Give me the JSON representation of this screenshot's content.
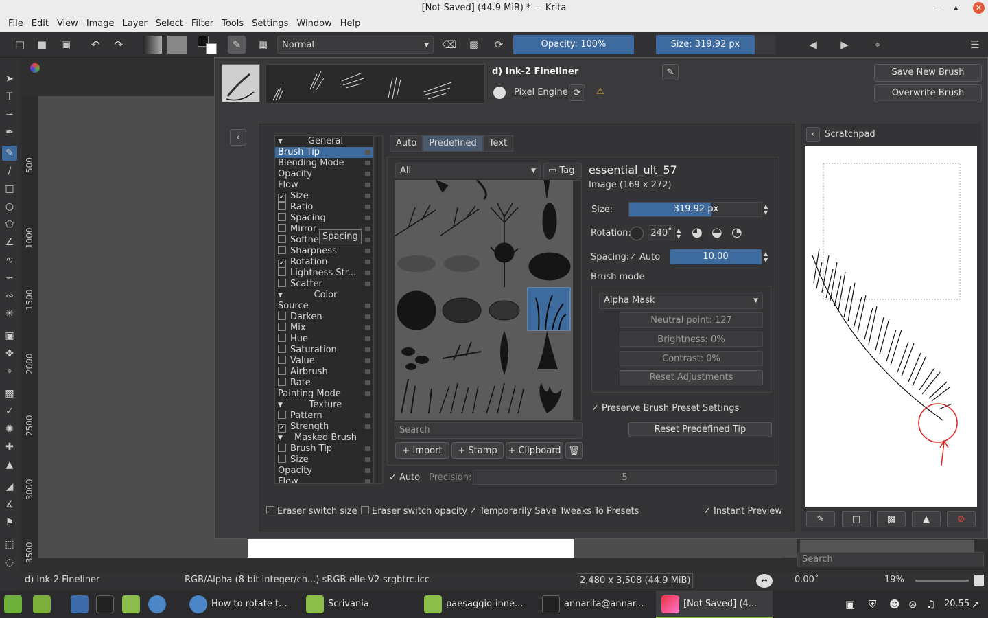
{
  "window": {
    "title": "[Not Saved]  (44.9 MiB)  * — Krita"
  },
  "menu": [
    "File",
    "Edit",
    "View",
    "Image",
    "Layer",
    "Select",
    "Filter",
    "Tools",
    "Settings",
    "Window",
    "Help"
  ],
  "toolbar": {
    "blend_mode": "Normal",
    "opacity": "Opacity: 100%",
    "size": "Size: 319.92 px"
  },
  "preset": {
    "name": "d) Ink-2 Fineliner",
    "engine": "Pixel Engine",
    "save_new": "Save New Brush Preset...",
    "overwrite": "Overwrite Brush"
  },
  "options_list": [
    {
      "label": "General",
      "type": "header"
    },
    {
      "label": "Brush Tip",
      "type": "plain",
      "selected": true
    },
    {
      "label": "Blending Mode",
      "type": "plain"
    },
    {
      "label": "Opacity",
      "type": "plain"
    },
    {
      "label": "Flow",
      "type": "plain"
    },
    {
      "label": "Size",
      "type": "check",
      "checked": true
    },
    {
      "label": "Ratio",
      "type": "check"
    },
    {
      "label": "Spacing",
      "type": "check"
    },
    {
      "label": "Mirror",
      "type": "check"
    },
    {
      "label": "Softnes",
      "type": "check"
    },
    {
      "label": "Sharpness",
      "type": "check"
    },
    {
      "label": "Rotation",
      "type": "check",
      "checked": true
    },
    {
      "label": "Lightness Str...",
      "type": "check"
    },
    {
      "label": "Scatter",
      "type": "check"
    },
    {
      "label": "Color",
      "type": "header"
    },
    {
      "label": "Source",
      "type": "plain"
    },
    {
      "label": "Darken",
      "type": "check"
    },
    {
      "label": "Mix",
      "type": "check"
    },
    {
      "label": "Hue",
      "type": "check"
    },
    {
      "label": "Saturation",
      "type": "check"
    },
    {
      "label": "Value",
      "type": "check"
    },
    {
      "label": "Airbrush",
      "type": "check"
    },
    {
      "label": "Rate",
      "type": "check"
    },
    {
      "label": "Painting Mode",
      "type": "plain"
    },
    {
      "label": "Texture",
      "type": "header"
    },
    {
      "label": "Pattern",
      "type": "check"
    },
    {
      "label": "Strength",
      "type": "check",
      "checked": true
    },
    {
      "label": "Masked Brush",
      "type": "header"
    },
    {
      "label": "Brush Tip",
      "type": "check"
    },
    {
      "label": "Size",
      "type": "check"
    },
    {
      "label": "Opacity",
      "type": "plain"
    },
    {
      "label": "Flow",
      "type": "plain"
    }
  ],
  "tooltip": "Spacing",
  "tip_tabs": [
    "Auto",
    "Predefined",
    "Text"
  ],
  "filter": {
    "selected": "All",
    "tag": "Tag",
    "search_placeholder": "Search"
  },
  "tip_buttons": {
    "import": "Import",
    "stamp": "Stamp",
    "clipboard": "Clipboard"
  },
  "tip_info": {
    "name": "essential_ult_57",
    "dims": "Image (169 x 272)"
  },
  "params": {
    "size_label": "Size:",
    "size_value": "319.92 px",
    "size_fraction": 0.62,
    "rotation_label": "Rotation:",
    "rotation_value": "240˚",
    "spacing_label": "Spacing:",
    "spacing_auto": "Auto",
    "spacing_value": "10.00",
    "brush_mode_label": "Brush mode",
    "brush_mode": "Alpha Mask",
    "neutral": "Neutral point: 127",
    "brightness": "Brightness: 0%",
    "contrast": "Contrast: 0%",
    "reset_adj": "Reset Adjustments",
    "preserve": "Preserve Brush Preset Settings",
    "reset_tip": "Reset Predefined Tip"
  },
  "precision": {
    "auto": "Auto",
    "label": "Precision:",
    "value": "5"
  },
  "bottom_opts": {
    "eraser_size": "Eraser switch size",
    "eraser_opacity": "Eraser switch opacity",
    "temp_save": "Temporarily Save Tweaks To Presets",
    "instant": "Instant Preview"
  },
  "scratchpad": {
    "title": "Scratchpad"
  },
  "ruler": [
    "500",
    "1000",
    "1500",
    "2000",
    "2500",
    "3000",
    "3500"
  ],
  "status": {
    "preset": "d) Ink-2 Fineliner",
    "color": "RGB/Alpha (8-bit integer/ch...)  sRGB-elle-V2-srgbtrc.icc",
    "dims": "2,480 x 3,508 (44.9 MiB)",
    "angle": "0.00˚",
    "zoom": "19%"
  },
  "right_docker": {
    "search_placeholder": "Search"
  },
  "taskbar": {
    "items": [
      "How to rotate t...",
      "Scrivania",
      "paesaggio-inne...",
      "annarita@annar...",
      "[Not Saved]  (4..."
    ],
    "clock": "20.55"
  }
}
